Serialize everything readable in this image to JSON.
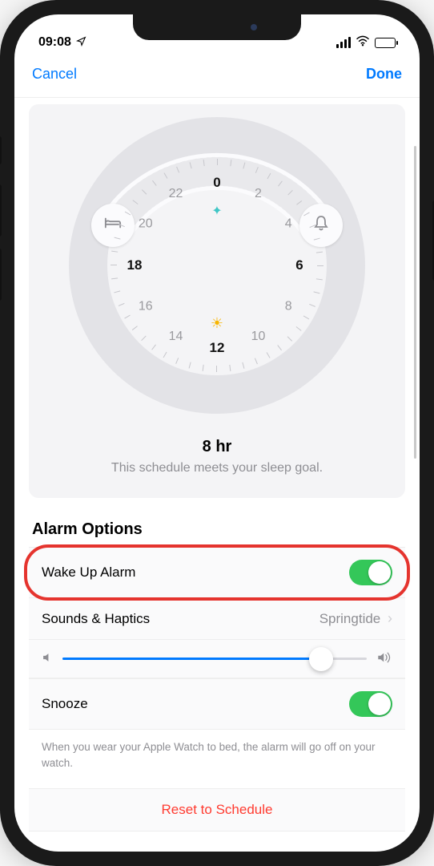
{
  "status": {
    "time": "09:08"
  },
  "navbar": {
    "cancel": "Cancel",
    "done": "Done"
  },
  "dial": {
    "hours": [
      "0",
      "2",
      "4",
      "6",
      "8",
      "10",
      "12",
      "14",
      "16",
      "18",
      "20",
      "22"
    ],
    "bold": [
      "0",
      "6",
      "12",
      "18"
    ],
    "duration": "8 hr",
    "goal_msg": "This schedule meets your sleep goal."
  },
  "alarm": {
    "section_title": "Alarm Options",
    "wake_label": "Wake Up Alarm",
    "wake_on": true,
    "sounds_label": "Sounds & Haptics",
    "sounds_value": "Springtide",
    "snooze_label": "Snooze",
    "snooze_on": true,
    "helper": "When you wear your Apple Watch to bed, the alarm will go off on your watch.",
    "reset": "Reset to Schedule"
  },
  "colors": {
    "accent": "#007aff",
    "toggle_on": "#34c759",
    "destructive": "#ff3b30"
  }
}
